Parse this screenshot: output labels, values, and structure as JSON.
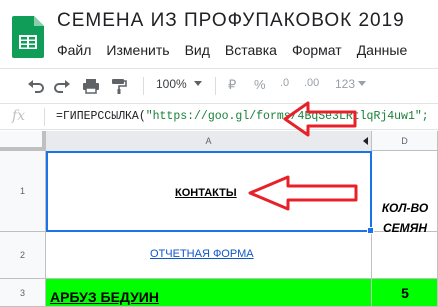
{
  "header": {
    "title": "СЕМЕНА ИЗ ПРОФУПАКОВОК 2019",
    "app_icon": "google-sheets-icon"
  },
  "menu": {
    "items": [
      "Файл",
      "Изменить",
      "Вид",
      "Вставка",
      "Формат",
      "Данные"
    ]
  },
  "toolbar": {
    "zoom": "100%",
    "currency": "₽",
    "percent": "%",
    "dec_decrease": ".0",
    "dec_increase": ".00",
    "more_formats": "123"
  },
  "formula_bar": {
    "fx_label": "fx",
    "function": "=ГИПЕРССЫЛКА(",
    "url": "\"https://goo.gl/forms/4BqSe3LRtlqRj4uw1\";"
  },
  "grid": {
    "columns": [
      {
        "label": "A"
      },
      {
        "label": "D"
      }
    ],
    "rows": [
      {
        "number": "1",
        "a": "КОНТАКТЫ",
        "d": "КОЛ-ВО СЕМЯН"
      },
      {
        "number": "2",
        "a": "ОТЧЕТНАЯ ФОРМА",
        "d": ""
      },
      {
        "number": "3",
        "a": "АРБУЗ БЕДУИН",
        "d": "5"
      }
    ]
  },
  "colors": {
    "sheets_green": "#0f9d58",
    "selection_blue": "#1a73e8",
    "highlight_green": "#00ff00",
    "annotation_red": "#e8202a",
    "link_blue": "#1155cc"
  }
}
